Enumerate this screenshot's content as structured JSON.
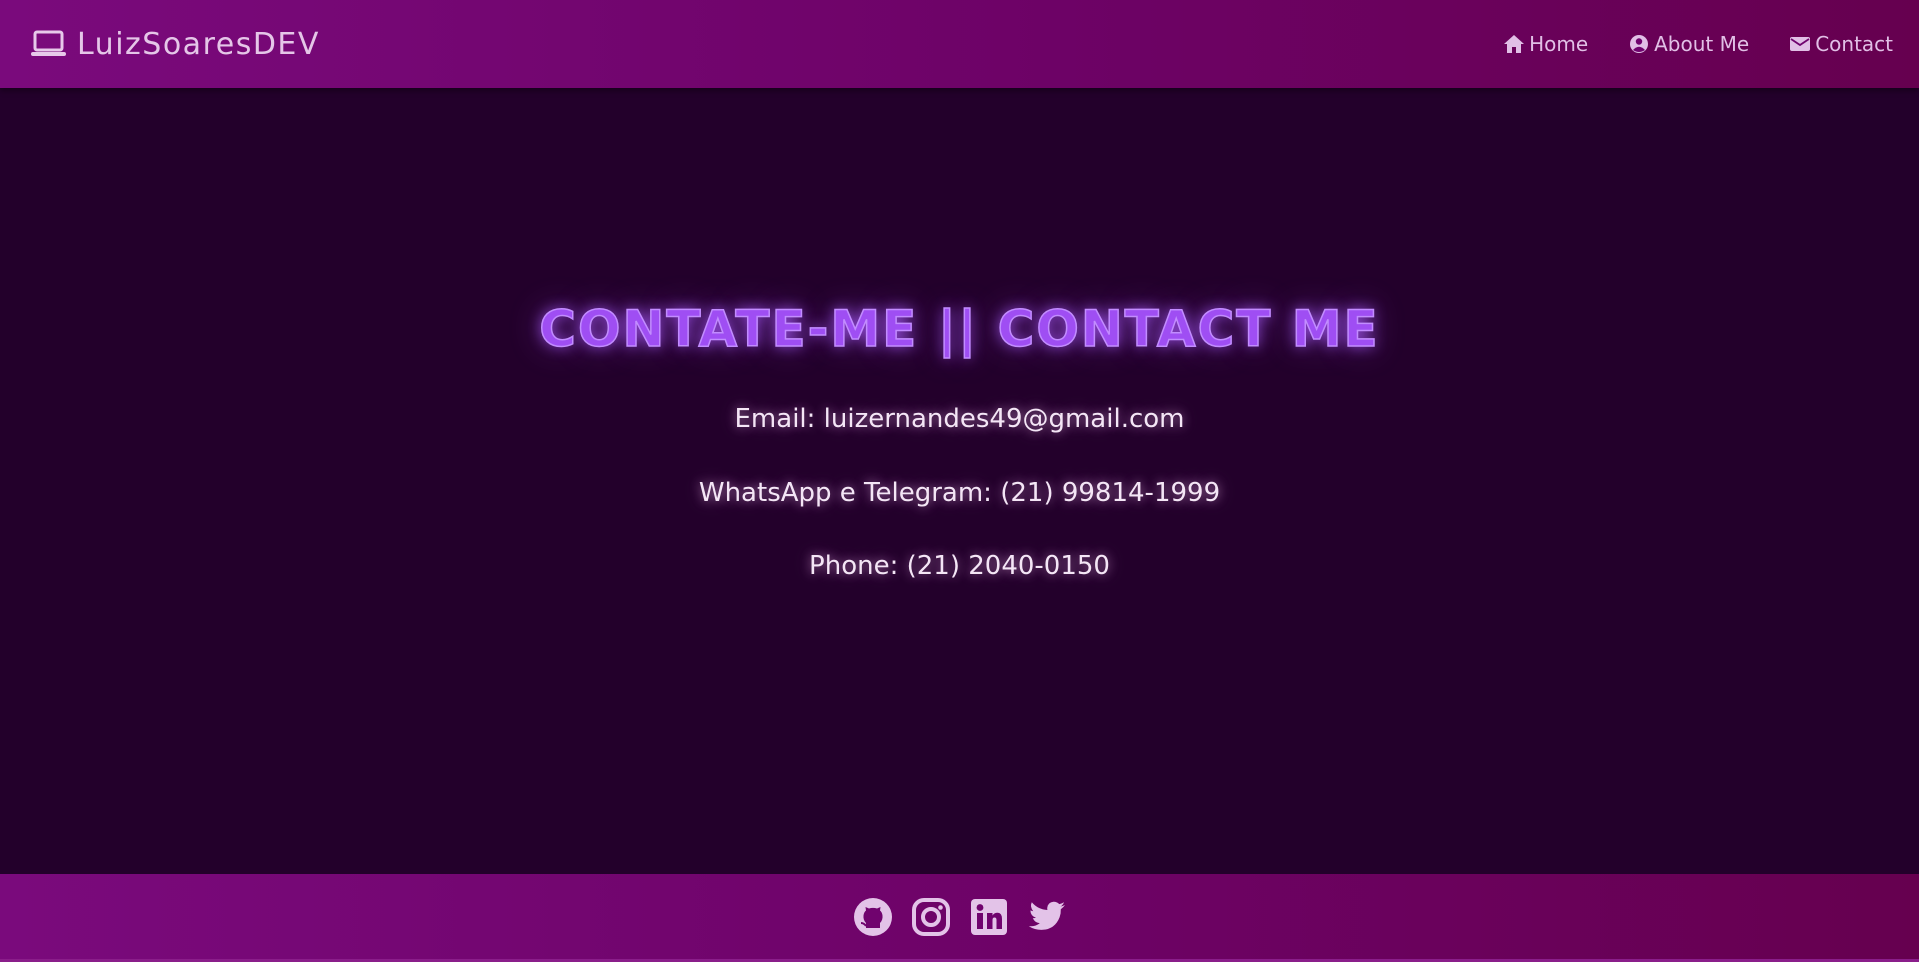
{
  "navbar": {
    "brand": {
      "icon": "laptop-icon",
      "text": "LuizSoaresDEV"
    },
    "links": [
      {
        "icon": "home-icon",
        "label": "Home"
      },
      {
        "icon": "user-circle-icon",
        "label": "About Me"
      },
      {
        "icon": "envelope-icon",
        "label": "Contact"
      }
    ]
  },
  "main": {
    "title": "CONTATE-ME || CONTACT ME",
    "email": "Email: luizernandes49@gmail.com",
    "whatsapp": "WhatsApp e Telegram: (21) 99814-1999",
    "phone": "Phone: (21) 2040-0150"
  },
  "footer": {
    "social": [
      {
        "icon": "github-icon"
      },
      {
        "icon": "instagram-icon"
      },
      {
        "icon": "linkedin-icon"
      },
      {
        "icon": "twitter-icon"
      }
    ]
  },
  "colors": {
    "navbar_bg": "#70036e",
    "page_bg": "#23002b",
    "title": "#9f4ef3",
    "text": "#f4e6f6",
    "nav_text": "#e1bfe6"
  }
}
